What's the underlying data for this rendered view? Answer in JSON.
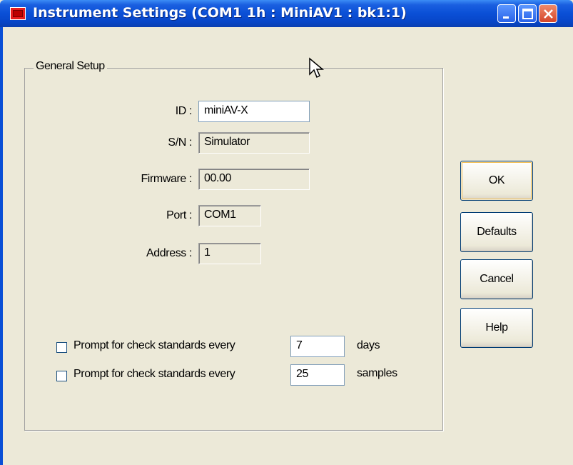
{
  "window": {
    "title": "Instrument Settings (COM1 1h : MiniAV1 : bk1:1)",
    "accent_color": "#0a4fd6",
    "icons": [
      "app-icon",
      "minimize-icon",
      "maximize-icon",
      "close-icon"
    ]
  },
  "group": {
    "label": "General Setup"
  },
  "fields": {
    "id_label": "ID :",
    "id_value": "miniAV-X",
    "sn_label": "S/N :",
    "sn_value": "Simulator",
    "firmware_label": "Firmware :",
    "firmware_value": "00.00",
    "port_label": "Port :",
    "port_value": "COM1",
    "address_label": "Address :",
    "address_value": "1"
  },
  "checks": [
    {
      "label": "Prompt for check standards every",
      "value": "7",
      "unit": "days",
      "checked": false
    },
    {
      "label": "Prompt for check standards every",
      "value": "25",
      "unit": "samples",
      "checked": false
    }
  ],
  "buttons": {
    "ok": "OK",
    "defaults": "Defaults",
    "cancel": "Cancel",
    "help": "Help"
  }
}
